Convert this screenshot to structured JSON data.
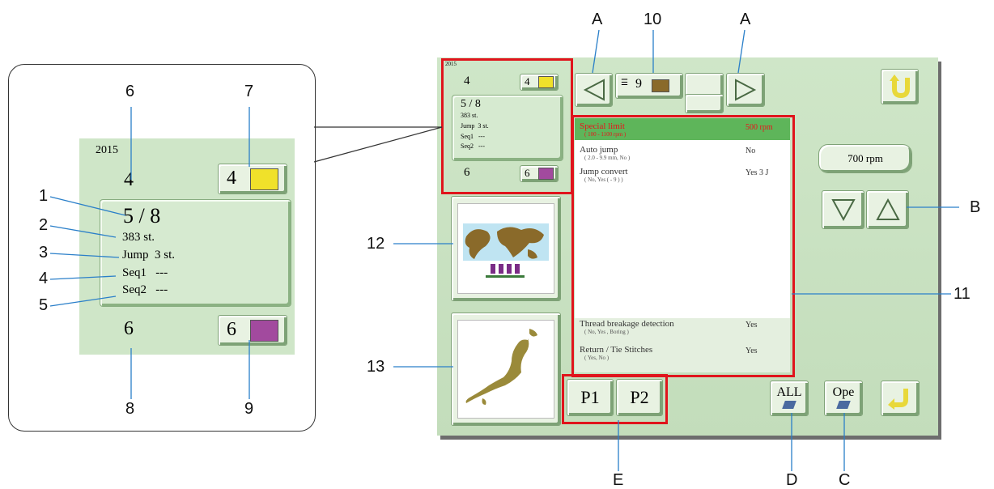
{
  "callouts": {
    "n1": "1",
    "n2": "2",
    "n3": "3",
    "n4": "4",
    "n5": "5",
    "n6": "6",
    "n7": "7",
    "n8": "8",
    "n9": "9",
    "n10": "10",
    "n11": "11",
    "n12": "12",
    "n13": "13",
    "A": "A",
    "B": "B",
    "C": "C",
    "D": "D",
    "E": "E"
  },
  "zoom": {
    "year": "2015",
    "top_left_num": "4",
    "top_color_num": "4",
    "fraction": "5 / 8",
    "stitches": "383 st.",
    "jump": "Jump  3 st.",
    "seq1": "Seq1   ---",
    "seq2": "Seq2   ---",
    "bottom_left_num": "6",
    "bottom_color_num": "6",
    "top_color": "#f0e12a",
    "bottom_color": "#a24a9e"
  },
  "screen": {
    "year": "2015",
    "top_left_num": "4",
    "top_color_num": "4",
    "fraction": "5 / 8",
    "stitches": "383 st.",
    "jump": "Jump  3 st.",
    "seq1": "Seq1   ---",
    "seq2": "Seq2   ---",
    "bottom_left_num": "6",
    "bottom_color_num": "6",
    "needle_num": "9",
    "needle_color": "#8a6a2a",
    "speed": "700 rpm",
    "p1": "P1",
    "p2": "P2",
    "all": "ALL",
    "ope": "Ope",
    "settings": [
      {
        "label": "Special limit",
        "sub": "( 100 - 1100 rpm )",
        "value": "500 rpm",
        "highlight": true
      },
      {
        "label": "Auto jump",
        "sub": "( 2.0 - 9.9 mm, No )",
        "value": "No",
        "highlight": false
      },
      {
        "label": "Jump convert",
        "sub": "( No, Yes ( - 9 ) )",
        "value": "Yes  3 J",
        "highlight": false
      },
      {
        "label": "Thread breakage detection",
        "sub": "( No, Yes , Boring )",
        "value": "Yes",
        "highlight": false
      },
      {
        "label": "Return / Tie Stitches",
        "sub": "( Yes, No )",
        "value": "Yes",
        "highlight": false
      }
    ]
  },
  "colors": {
    "accent_red": "#e0141c",
    "leader_blue": "#2a7fc9",
    "screen_green": "#c6dfbf"
  }
}
